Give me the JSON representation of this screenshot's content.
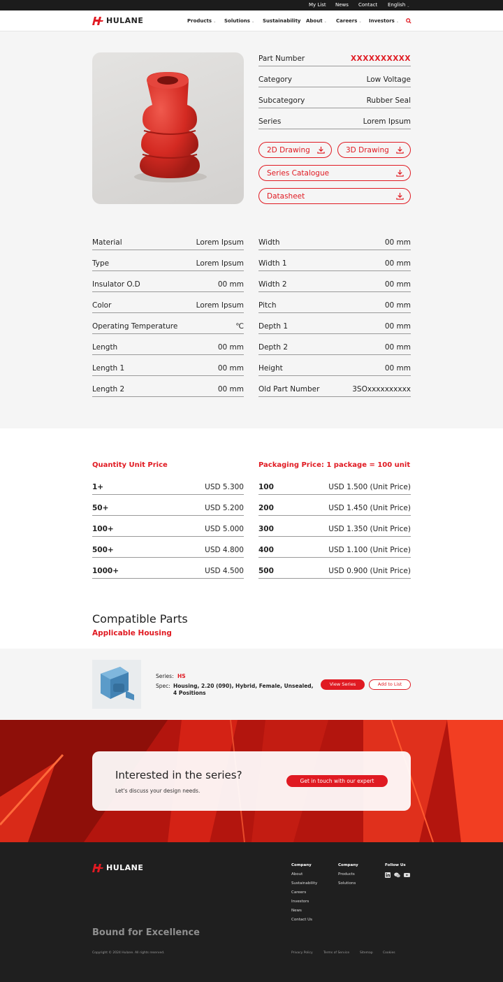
{
  "topbar": {
    "my_list": "My List",
    "news": "News",
    "contact": "Contact",
    "language": "English"
  },
  "brand": {
    "name": "HULANE",
    "color": "#e01a22"
  },
  "nav": {
    "items": [
      "Products",
      "Solutions",
      "Sustainability",
      "About",
      "Careers",
      "Investors"
    ],
    "search_icon": "search-icon"
  },
  "product": {
    "part_number_label": "Part Number",
    "part_number_value": "XXXXXXXXXX",
    "category_label": "Category",
    "category_value": "Low Voltage",
    "subcategory_label": "Subcategory",
    "subcategory_value": "Rubber Seal",
    "series_label": "Series",
    "series_value": "Lorem Ipsum",
    "downloads": {
      "drawing_2d": "2D Drawing",
      "drawing_3d": "3D Drawing",
      "catalogue": "Series Catalogue",
      "datasheet": "Datasheet"
    }
  },
  "specs_left": [
    {
      "label": "Material",
      "value": "Lorem Ipsum"
    },
    {
      "label": "Type",
      "value": "Lorem Ipsum"
    },
    {
      "label": "Insulator O.D",
      "value": "00 mm"
    },
    {
      "label": "Color",
      "value": "Lorem Ipsum"
    },
    {
      "label": "Operating Temperature",
      "value": "℃"
    },
    {
      "label": "Length",
      "value": "00 mm"
    },
    {
      "label": "Length 1",
      "value": "00 mm"
    },
    {
      "label": "Length 2",
      "value": "00 mm"
    }
  ],
  "specs_right": [
    {
      "label": "Width",
      "value": "00 mm"
    },
    {
      "label": "Width 1",
      "value": "00 mm"
    },
    {
      "label": "Width 2",
      "value": "00 mm"
    },
    {
      "label": "Pitch",
      "value": "00 mm"
    },
    {
      "label": "Depth 1",
      "value": "00 mm"
    },
    {
      "label": "Depth 2",
      "value": "00 mm"
    },
    {
      "label": "Height",
      "value": "00 mm"
    },
    {
      "label": "Old Part Number",
      "value": "3SOxxxxxxxxxx"
    }
  ],
  "pricing": {
    "quantity_title": "Quantity Unit Price",
    "packaging_title": "Packaging Price: 1 package = 100 unit",
    "quantity": [
      {
        "qty": "1+",
        "price": "USD 5.300"
      },
      {
        "qty": "50+",
        "price": "USD 5.200"
      },
      {
        "qty": "100+",
        "price": "USD 5.000"
      },
      {
        "qty": "500+",
        "price": "USD 4.800"
      },
      {
        "qty": "1000+",
        "price": "USD 4.500"
      }
    ],
    "packaging": [
      {
        "qty": "100",
        "price": "USD 1.500 (Unit Price)"
      },
      {
        "qty": "200",
        "price": "USD 1.450 (Unit Price)"
      },
      {
        "qty": "300",
        "price": "USD 1.350 (Unit Price)"
      },
      {
        "qty": "400",
        "price": "USD 1.100 (Unit Price)"
      },
      {
        "qty": "500",
        "price": "USD 0.900 (Unit Price)"
      }
    ]
  },
  "compatible": {
    "title": "Compatible Parts",
    "subtitle": "Applicable Housing",
    "series_label": "Series:",
    "series_value": "HS",
    "spec_label": "Spec:",
    "spec_value_1": "Housing, 2.20 (090), Hybrid, Female, Unsealed,",
    "spec_value_2": "4 Positions",
    "view_button": "View Series",
    "add_button": "Add to List"
  },
  "cta": {
    "title": "Interested in the series?",
    "subtitle": "Let's discuss your design needs.",
    "button": "Get in touch with our expert"
  },
  "footer": {
    "tagline": "Bound for Excellence",
    "col1_title": "Company",
    "col1": [
      "About",
      "Sustainability",
      "Careers",
      "Investors",
      "News",
      "Contact Us"
    ],
    "col2_title": "Company",
    "col2": [
      "Products",
      "Solutions"
    ],
    "follow_title": "Follow Us",
    "copyright": "Copyright © 2024 Hulane. All rights reserved.",
    "legal": [
      "Privacy Policy",
      "Terms of Service",
      "Sitemap",
      "Cookies"
    ]
  }
}
